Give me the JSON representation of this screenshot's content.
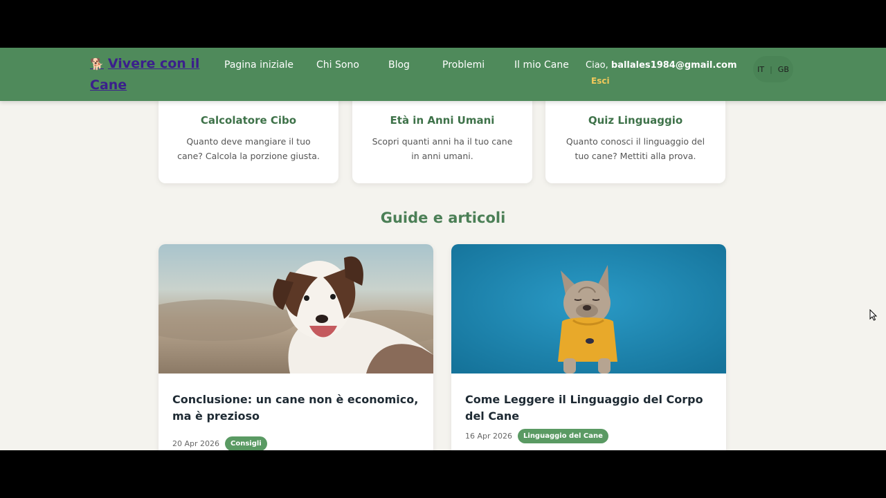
{
  "nav": {
    "brand_icon": "🐕",
    "brand": "Vivere con il Cane",
    "links": [
      "Pagina iniziale",
      "Chi Sono",
      "Blog",
      "Problemi",
      "Il mio Cane"
    ],
    "greeting_prefix": "Ciao,",
    "user_email": "ballales1984@gmail.com",
    "logout": "Esci",
    "languages": [
      "IT",
      "GB"
    ]
  },
  "tools": [
    {
      "title": "Calcolatore Cibo",
      "desc": "Quanto deve mangiare il tuo cane? Calcola la porzione giusta."
    },
    {
      "title": "Età in Anni Umani",
      "desc": "Scopri quanti anni ha il tuo cane in anni umani."
    },
    {
      "title": "Quiz Linguaggio",
      "desc": "Quanto conosci il linguaggio del tuo cane? Mettiti alla prova."
    }
  ],
  "articles_section": {
    "title": "Guide e articoli",
    "items": [
      {
        "title": "Conclusione: un cane non è economico, ma è prezioso",
        "date": "20 Apr 2026",
        "tag": "Consigli",
        "image": "border-collie-dog-photo"
      },
      {
        "title": "Come Leggere il Linguaggio del Corpo del Cane",
        "date": "16 Apr 2026",
        "tag": "Linguaggio del Cane",
        "image": "french-bulldog-photo"
      }
    ]
  },
  "colors": {
    "navbar": "#4f8a5b",
    "accent_green": "#4b7f56",
    "tag_green": "#5a9a63",
    "background": "#f4f3ee"
  }
}
